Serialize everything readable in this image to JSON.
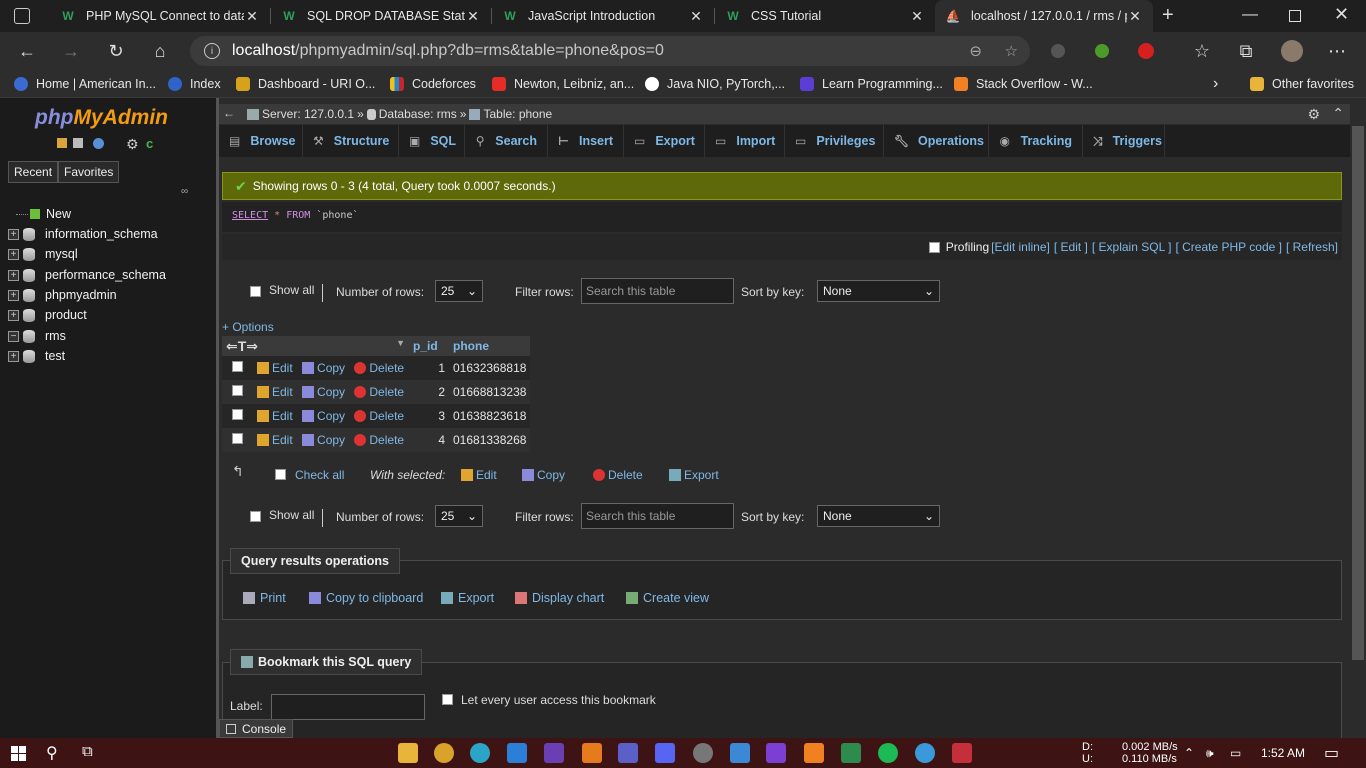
{
  "browser": {
    "tabs": [
      {
        "label": "PHP MySQL Connect to datab",
        "active": false
      },
      {
        "label": "SQL DROP DATABASE Statem",
        "active": false
      },
      {
        "label": "JavaScript Introduction",
        "active": false
      },
      {
        "label": "CSS Tutorial",
        "active": false
      },
      {
        "label": "localhost / 127.0.0.1 / rms / p",
        "active": true
      }
    ],
    "url_host": "localhost",
    "url_path": "/phpmyadmin/sql.php?db=rms&table=phone&pos=0",
    "bookmarks": [
      "Home | American In...",
      "Index",
      "Dashboard - URI O...",
      "Codeforces",
      "Newton, Leibniz, an...",
      "Java NIO, PyTorch,...",
      "Learn Programming...",
      "Stack Overflow - W..."
    ],
    "other_favorites": "Other favorites"
  },
  "left": {
    "logo_php": "php",
    "logo_my": "MyAdmin",
    "recent": "Recent",
    "favorites": "Favorites",
    "new": "New",
    "databases": [
      "information_schema",
      "mysql",
      "performance_schema",
      "phpmyadmin",
      "product",
      "rms",
      "test"
    ]
  },
  "breadcrumb": {
    "server": "Server: 127.0.0.1",
    "database": "Database: rms",
    "table": "Table: phone"
  },
  "menu": [
    "Browse",
    "Structure",
    "SQL",
    "Search",
    "Insert",
    "Export",
    "Import",
    "Privileges",
    "Operations",
    "Tracking",
    "Triggers"
  ],
  "success": "Showing rows 0 - 3 (4 total, Query took 0.0007 seconds.)",
  "sql": {
    "select": "SELECT",
    "star": "*",
    "from": "FROM",
    "table": "`phone`"
  },
  "profiling": {
    "label": "Profiling",
    "links": [
      "[Edit inline]",
      "[ Edit ]",
      "[ Explain SQL ]",
      "[ Create PHP code ]",
      "[ Refresh]"
    ]
  },
  "controls": {
    "show_all": "Show all",
    "num_rows_label": "Number of rows:",
    "num_rows": "25",
    "filter_label": "Filter rows:",
    "filter_placeholder": "Search this table",
    "sort_label": "Sort by key:",
    "sort_value": "None"
  },
  "options": "+ Options",
  "table": {
    "columns": [
      "p_id",
      "phone"
    ],
    "rows": [
      {
        "p_id": "1",
        "phone": "01632368818"
      },
      {
        "p_id": "2",
        "phone": "01668813238"
      },
      {
        "p_id": "3",
        "phone": "01638823618"
      },
      {
        "p_id": "4",
        "phone": "01681338268"
      }
    ],
    "edit": "Edit",
    "copy": "Copy",
    "delete": "Delete"
  },
  "bulk": {
    "check_all": "Check all",
    "with_selected": "With selected:",
    "edit": "Edit",
    "copy": "Copy",
    "delete": "Delete",
    "export": "Export"
  },
  "qro": {
    "title": "Query results operations",
    "links": [
      "Print",
      "Copy to clipboard",
      "Export",
      "Display chart",
      "Create view"
    ]
  },
  "bookmark": {
    "title": "Bookmark this SQL query",
    "label": "Label:",
    "share": "Let every user access this bookmark"
  },
  "console": "Console",
  "taskbar": {
    "net_down_label": "D:",
    "net_up_label": "U:",
    "net_down": "0.002 MB/s",
    "net_up": "0.110 MB/s",
    "time": "1:52 AM"
  }
}
